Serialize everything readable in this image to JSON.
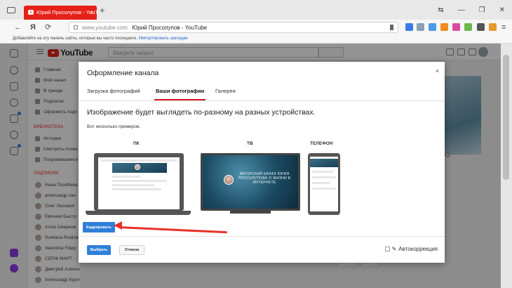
{
  "browser": {
    "tab_title": "Юрий Просолупов - YouTube",
    "tab_close": "×",
    "new_tab": "+",
    "window_buttons": [
      "⇆",
      "—",
      "❐",
      "✕"
    ],
    "back": "←",
    "brand": "Я",
    "refresh": "⟳",
    "url_host": "www.youtube.com",
    "url_title": "Юрий Просолупов - YouTube",
    "bookmarks_hint": "Добавляйте на эту панель сайты, которые вы часто посещаете.",
    "bookmarks_import": "Импортировать закладки"
  },
  "youtube": {
    "logo_text": "YouTube",
    "search_placeholder": "Введите запрос",
    "sidebar": {
      "main": [
        "Главная",
        "Мой канал",
        "В тренде",
        "Подписки",
        "Оформить подп"
      ],
      "library_heading": "БИБЛИОТЕКА",
      "library": [
        "История",
        "Смотреть позже",
        "Понравившиеся"
      ],
      "subs_heading": "ПОДПИСКИ",
      "subscriptions": [
        "Нина Позябина",
        "александр сан",
        "Олег Лисовой",
        "Евгения Быстр",
        "Алла Смирнов",
        "Svetlana Rodina",
        "Valentina Filipp",
        "СЕРЖ МАРТ",
        "Дмитрий Алексеевич",
        "Александр Курочкин"
      ]
    }
  },
  "modal": {
    "title": "Оформление канала",
    "close": "×",
    "tabs": [
      "Загрузка фотографий",
      "Ваши фотографии",
      "Галерея"
    ],
    "active_tab": 1,
    "heading": "Изображение будет выглядеть по-разному на разных устройствах.",
    "subheading": "Вот несколько примеров.",
    "devices": [
      "ПК",
      "ТВ",
      "ТЕЛЕФОН"
    ],
    "banner_text": "АВТОРСКИЙ КАНАЛ ЮРИЯ ПРОСОЛУПОВА О ЖИЗНИ В ИНТЕРНЕТЕ",
    "crop_button": "Кадрировать",
    "select_button": "Выбрать",
    "cancel_button": "Отмена",
    "autocorrection_label": "Автокоррекция",
    "autocorrection_checked": false
  },
  "colors": {
    "youtube_red": "#e62117",
    "primary_blue": "#2f7fd8",
    "arrow_red": "#e8312a"
  }
}
